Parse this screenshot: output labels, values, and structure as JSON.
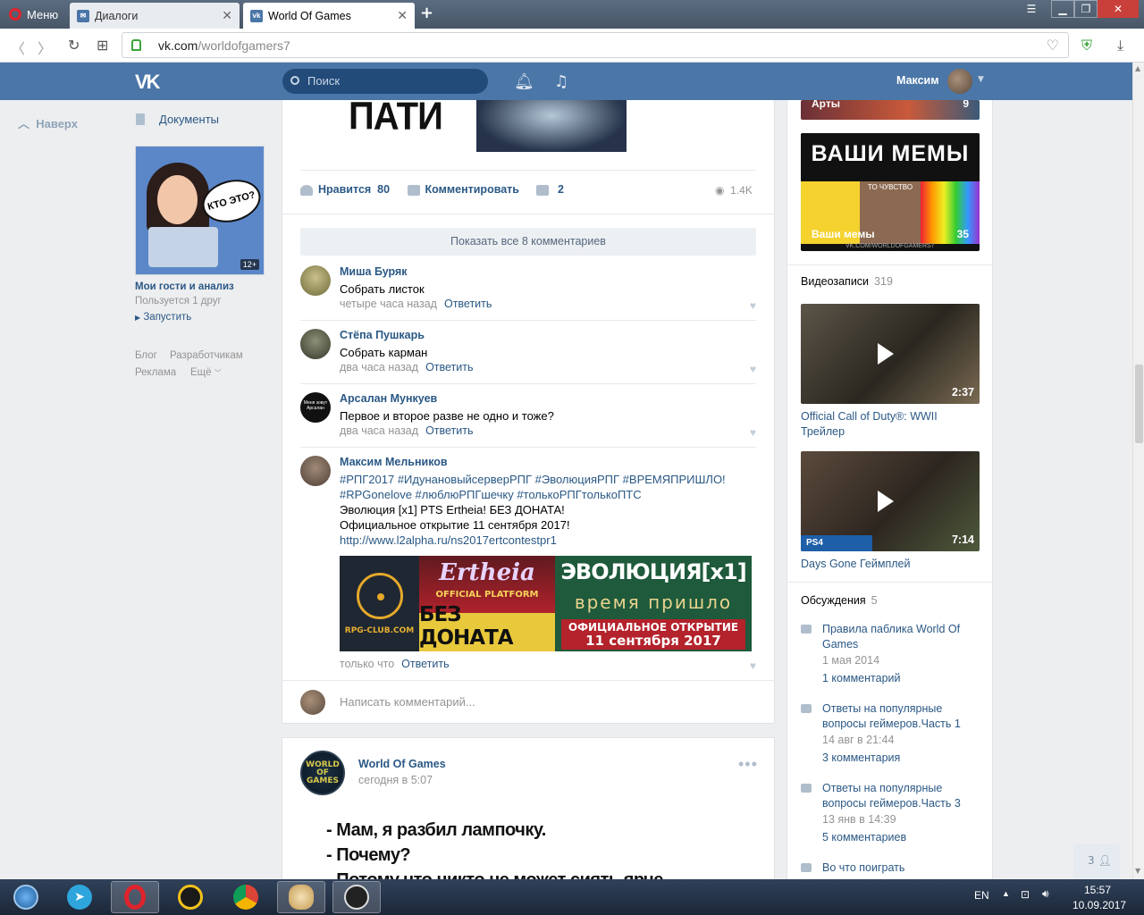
{
  "browser": {
    "menu_label": "Меню",
    "tabs": [
      {
        "label": "Диалоги",
        "active": false
      },
      {
        "label": "World Of Games",
        "active": true
      }
    ],
    "url_domain": "vk.com",
    "url_path": "/worldofgamers7"
  },
  "vk_header": {
    "search_placeholder": "Поиск",
    "user_name": "Максим"
  },
  "left_column": {
    "up_label": "Наверх",
    "docs_label": "Документы",
    "ad": {
      "bubble_text": "КТО ЭТО?",
      "age": "12+",
      "title": "Мои гости и анализ",
      "subtitle": "Пользуется 1 друг",
      "launch": "Запустить"
    },
    "footer": [
      "Блог",
      "Разработчикам",
      "Реклама",
      "Ещё"
    ]
  },
  "post1": {
    "image_text": "ПАТИ",
    "like_label": "Нравится",
    "like_count": "80",
    "comment_label": "Комментировать",
    "share_count": "2",
    "views": "1.4K",
    "show_all": "Показать все 8 комментариев",
    "comments": [
      {
        "name": "Миша Буряк",
        "text": "Собрать листок",
        "time": "четыре часа назад",
        "reply": "Ответить"
      },
      {
        "name": "Стёпа Пушкарь",
        "text": "Собрать карман",
        "time": "два часа назад",
        "reply": "Ответить"
      },
      {
        "name": "Арсалан Мункуев",
        "text": "Первое и второе разве не одно и тоже?",
        "time": "два часа назад",
        "reply": "Ответить"
      },
      {
        "name": "Максим Мельников",
        "hashtags1": "#РПГ2017 #ИдунановыйсерверРПГ #ЭволюцияРПГ #ВРЕМЯПРИШЛО!",
        "hashtags2": "#RPGonelove #люблюРПГшечку #толькоРПГтолькоПТС",
        "line3": "Эволюция [x1] PTS Ertheia! БЕЗ ДОНАТА!",
        "line4": "Официальное открытие 11 сентября 2017!",
        "link": "http://www.l2alpha.ru/ns2017ertcontestpr1",
        "time": "только что",
        "reply": "Ответить"
      }
    ],
    "banner": {
      "club": "RPG-CLUB.COM",
      "ertheia": "Ertheia",
      "platform": "OFFICIAL PLATFORM",
      "no_donate": "БЕЗ ДОНАТА",
      "evolution": "ЭВОЛЮЦИЯ[x1]",
      "time_has_come": "время пришло",
      "official_open": "ОФИЦИАЛЬНОЕ ОТКРЫТИЕ",
      "date": "11 сентября 2017"
    },
    "avatar_text": "Меня зовут Арсалан",
    "write_placeholder": "Написать комментарий..."
  },
  "post2": {
    "author": "World Of Games",
    "time": "сегодня в 5:07",
    "avatar_text": "WORLD OF GAMES",
    "lines": [
      "- Мам, я разбил лампочку.",
      "- Почему?",
      "- Потому что никто не может сиять ярче"
    ]
  },
  "right_column": {
    "album1_label": "Арты",
    "album1_count": "9",
    "memes_title": "ВАШИ МЕМЫ",
    "memes_sub": "ТО ЧУВСТВО",
    "memes_label": "Ваши мемы",
    "memes_count": "35",
    "memes_url": "VK.COM/WORLDOFGAMERS7",
    "videos_title": "Видеозаписи",
    "videos_count": "319",
    "videos": [
      {
        "title": "Official Call of Duty®: WWII Трейлер",
        "duration": "2:37"
      },
      {
        "title": "Days Gone Геймплей",
        "duration": "7:14",
        "badge": "PS4"
      }
    ],
    "discussions_title": "Обсуждения",
    "discussions_count": "5",
    "discussions": [
      {
        "title": "Правила паблика World Of Games",
        "date": "1 мая 2014",
        "comments": "1 комментарий"
      },
      {
        "title": "Ответы на популярные вопросы геймеров.Часть 1",
        "date": "14 авг в 21:44",
        "comments": "3 комментария"
      },
      {
        "title": "Ответы на популярные вопросы геймеров.Часть 3",
        "date": "13 янв в 14:39",
        "comments": "5 комментариев"
      },
      {
        "title": "Во что поиграть"
      }
    ],
    "friends_online": "3"
  },
  "taskbar": {
    "lang": "EN",
    "time": "15:57",
    "date": "10.09.2017"
  }
}
